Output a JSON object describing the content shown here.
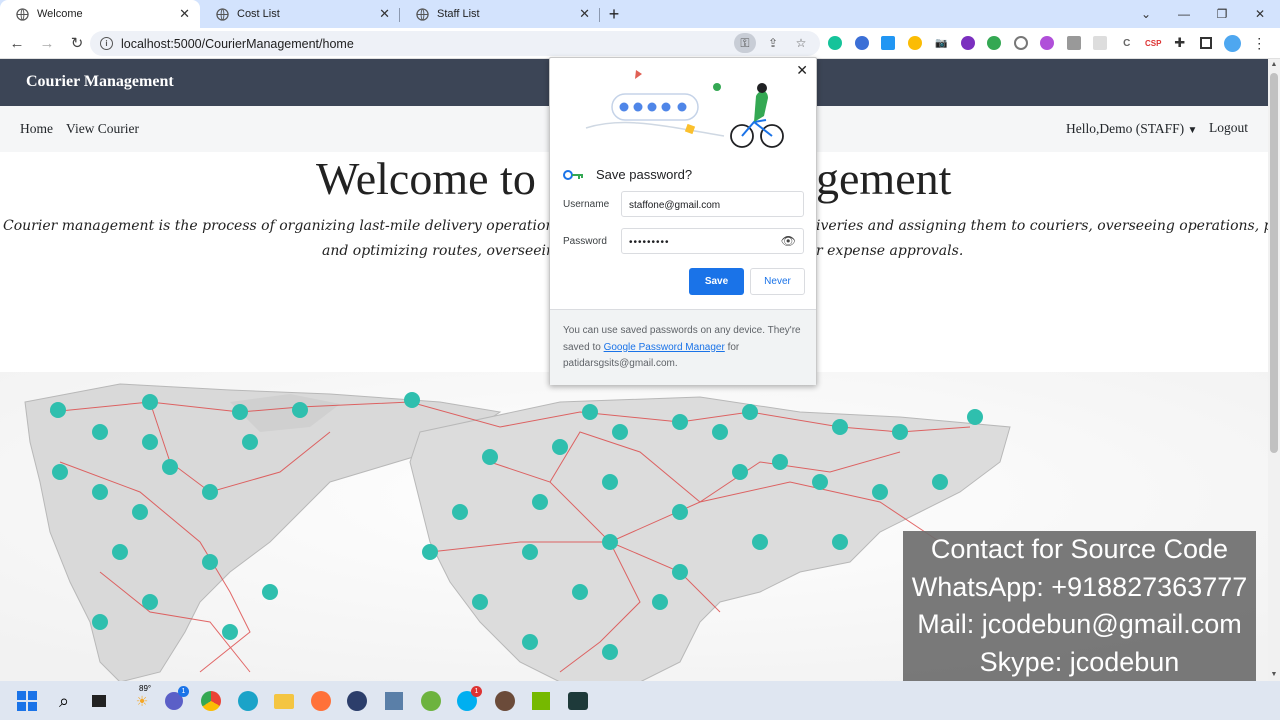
{
  "browser": {
    "tabs": [
      {
        "label": "Welcome",
        "active": true
      },
      {
        "label": "Cost List",
        "active": false
      },
      {
        "label": "Staff List",
        "active": false
      }
    ],
    "url": "localhost:5000/CourierManagement/home"
  },
  "app": {
    "brand": "Courier Management",
    "nav": {
      "home": "Home",
      "view_courier": "View Courier"
    },
    "user_menu": "Hello,Demo (STAFF)",
    "logout": "Logout",
    "welcome_left": "Welcome to",
    "welcome_right": "gement",
    "description_left_1": "Courier management is the process of organizing last-mile delivery operations. Courier",
    "description_right_1": "iveries and assigning them to couriers, overseeing operations, planning",
    "description_left_2": "and optimizing routes, overseeing ve",
    "description_right_2": "r expense approvals."
  },
  "password_dialog": {
    "title": "Save password?",
    "username_label": "Username",
    "username_value": "staffone@gmail.com",
    "password_label": "Password",
    "password_value": "•••••••••",
    "save_button": "Save",
    "never_button": "Never",
    "footer_text_1": "You can use saved passwords on any device. They're saved to",
    "footer_link": "Google Password Manager",
    "footer_text_2": "for",
    "footer_account": "patidarsgsits@gmail.com."
  },
  "overlay": {
    "line1": "Contact for Source Code",
    "line2": "WhatsApp: +918827363777",
    "line3": "Mail: jcodebun@gmail.com",
    "line4": "Skype: jcodebun"
  },
  "taskbar": {
    "weather": "89°",
    "teams_badge": "1",
    "skype_badge": "1"
  },
  "colors": {
    "appbar": "#3c4556",
    "accent": "#1a73e8",
    "tabbar": "#d3e3fd"
  }
}
